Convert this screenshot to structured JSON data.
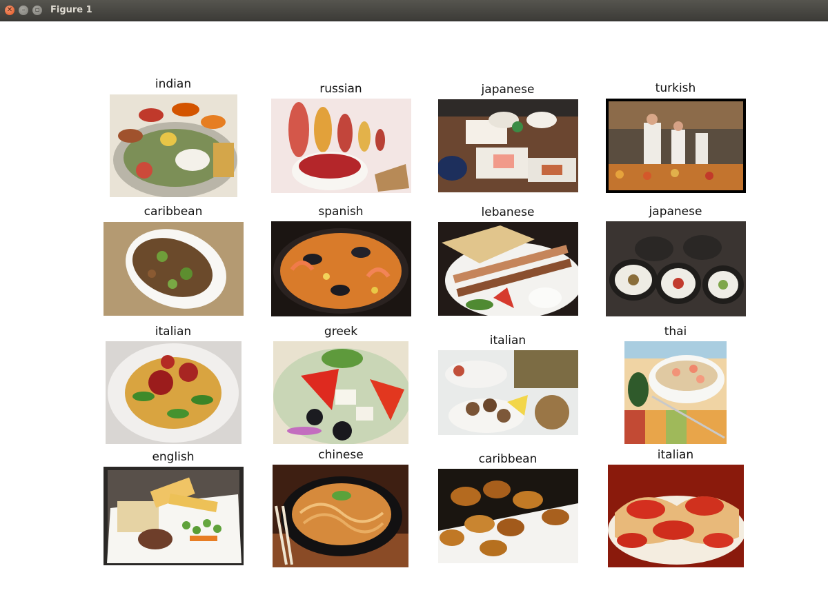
{
  "window": {
    "title": "Figure 1"
  },
  "grid": [
    {
      "label": "indian"
    },
    {
      "label": "russian"
    },
    {
      "label": "japanese"
    },
    {
      "label": "turkish"
    },
    {
      "label": "caribbean"
    },
    {
      "label": "spanish"
    },
    {
      "label": "lebanese"
    },
    {
      "label": "japanese"
    },
    {
      "label": "italian"
    },
    {
      "label": "greek"
    },
    {
      "label": "italian"
    },
    {
      "label": "thai"
    },
    {
      "label": "english"
    },
    {
      "label": "chinese"
    },
    {
      "label": "caribbean"
    },
    {
      "label": "italian"
    }
  ]
}
